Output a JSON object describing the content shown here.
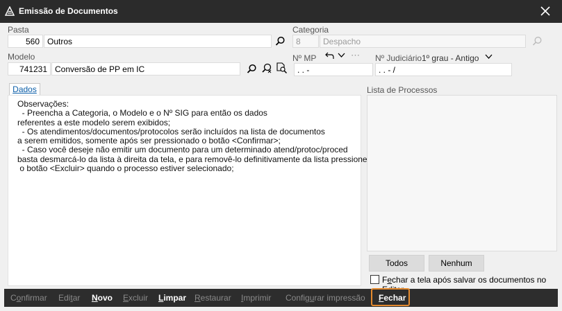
{
  "window": {
    "title": "Emissão de Documentos"
  },
  "pasta": {
    "label": "Pasta",
    "code": "560",
    "name": "Outros"
  },
  "categoria": {
    "label": "Categoria",
    "code": "8",
    "name": "Despacho"
  },
  "modelo": {
    "label": "Modelo",
    "code": "741231",
    "name": "Conversão de PP em IC"
  },
  "nmp": {
    "label": "Nº MP",
    "value": ".    .        -"
  },
  "njud": {
    "label": "Nº Judiciário",
    "grau": "1º grau - Antigo",
    "value": ".    .      - /"
  },
  "tabs": [
    {
      "label": "Dados"
    }
  ],
  "observacoes": "Observações:\n  - Preencha a Categoria, o Modelo e o Nº SIG para então os dados\nreferentes a este modelo serem exibidos;\n  - Os atendimentos/documentos/protocolos serão incluídos na lista de documentos\na serem emitidos, somente após ser pressionado o botão <Confirmar>;\n  - Caso você deseje não emitir um documento para um determinado atend/protoc/proced\nbasta desmarcá-lo da lista à direita da tela, e para removê-lo definitivamente da lista pressione\n o botão <Excluir> quando o processo estiver selecionado;",
  "lista_processos": {
    "label": "Lista de Processos"
  },
  "buttons": {
    "todos": "Todos",
    "nenhum": "Nenhum"
  },
  "checkbox": {
    "pre": "F",
    "u": "e",
    "post": "char a tela após salvar os documentos no Editor",
    "checked": false
  },
  "footer": [
    {
      "pre": "C",
      "u": "o",
      "post": "nfirmar",
      "enabled": false
    },
    {
      "pre": "Edi",
      "u": "t",
      "post": "ar",
      "enabled": false
    },
    {
      "pre": "",
      "u": "N",
      "post": "ovo",
      "enabled": true
    },
    {
      "pre": "",
      "u": "E",
      "post": "xcluir",
      "enabled": false
    },
    {
      "pre": "",
      "u": "L",
      "post": "impar",
      "enabled": true
    },
    {
      "pre": "",
      "u": "R",
      "post": "estaurar",
      "enabled": false
    },
    {
      "pre": "",
      "u": "I",
      "post": "mprimir",
      "enabled": false
    },
    {
      "pre": "Config",
      "u": "u",
      "post": "rar impressão",
      "enabled": false
    },
    {
      "pre": "",
      "u": "F",
      "post": "echar",
      "enabled": true
    }
  ],
  "colors": {
    "titlebar": "#2b2b2b",
    "footer": "#2d2d2d",
    "highlight": "#e58a2e",
    "tab_text": "#0b5ea8"
  }
}
